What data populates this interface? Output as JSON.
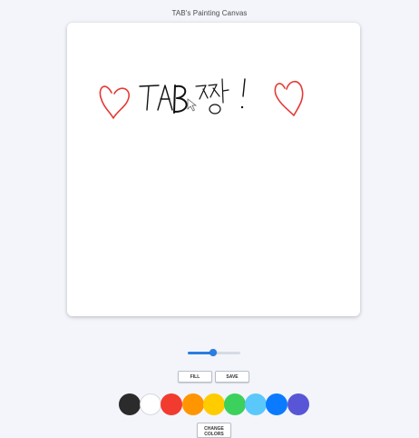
{
  "page": {
    "title": "TAB's Painting Canvas"
  },
  "canvas": {
    "drawing": {
      "icons": [
        "heart-doodle",
        "heart-doodle"
      ],
      "stroke_color": "#111111",
      "heart_color": "#e53935",
      "text_hint": "TAB 짱!"
    }
  },
  "brush": {
    "size_fraction": 0.48
  },
  "controls": {
    "fill_label": "FILL",
    "save_label": "SAVE",
    "change_colors_line1": "CHANGE",
    "change_colors_line2": "COLORS"
  },
  "palette": {
    "colors": [
      "#2b2b2b",
      "#ffffff",
      "#f23b2f",
      "#ff9500",
      "#ffcc00",
      "#3cd05c",
      "#5ac8fa",
      "#0a7bff",
      "#5856d6"
    ]
  }
}
